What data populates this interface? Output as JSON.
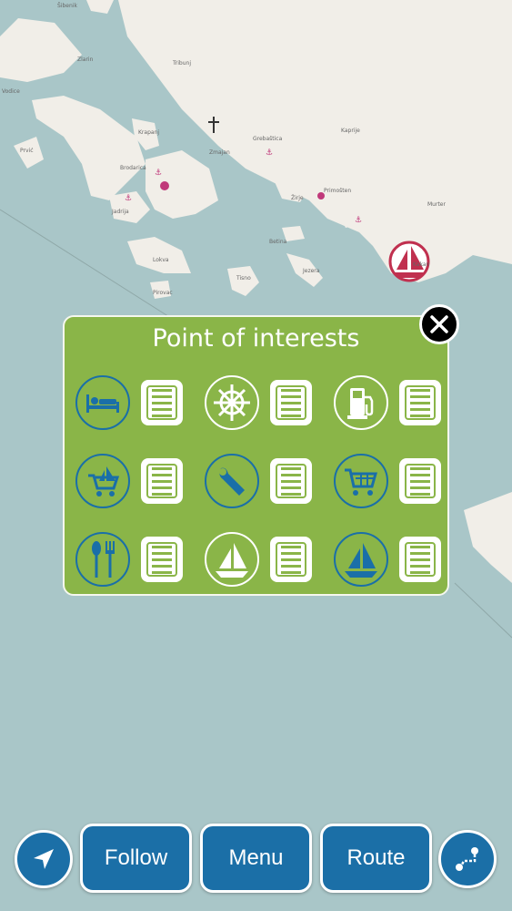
{
  "map": {
    "labels": [
      "Šibenik",
      "Zlarin",
      "Vodice",
      "Prvić",
      "Krapanj",
      "Brodarica",
      "Jadrija",
      "Tribunj",
      "Grebaštica",
      "Kaprije",
      "Žirje",
      "Primošten",
      "Murter",
      "Betina",
      "Jezera",
      "Tisno",
      "Pirovac",
      "Lokva",
      "Kakan",
      "Zmajan"
    ],
    "water_color": "#a9c6c8",
    "land_color": "#f1eee8"
  },
  "poi": {
    "title": "Point of interests",
    "categories": [
      {
        "name": "accommodation",
        "icon": "bed-icon",
        "style": "blue"
      },
      {
        "name": "marina",
        "icon": "ship-wheel-icon",
        "style": "white"
      },
      {
        "name": "fuel",
        "icon": "fuel-pump-icon",
        "style": "white"
      },
      {
        "name": "nautical-shop",
        "icon": "boat-cart-icon",
        "style": "blue"
      },
      {
        "name": "service",
        "icon": "wrench-icon",
        "style": "blue"
      },
      {
        "name": "shop",
        "icon": "shopping-cart-icon",
        "style": "blue"
      },
      {
        "name": "restaurant",
        "icon": "fork-spoon-icon",
        "style": "blue"
      },
      {
        "name": "sailing",
        "icon": "sailboat-white-icon",
        "style": "white"
      },
      {
        "name": "anchorage",
        "icon": "sailboat-blue-icon",
        "style": "blue"
      }
    ]
  },
  "bottom_bar": {
    "follow_label": "Follow",
    "menu_label": "Menu",
    "route_label": "Route"
  },
  "colors": {
    "panel_green": "#8ab548",
    "button_blue": "#1b6fa7",
    "icon_blue": "#1a6fa8"
  }
}
